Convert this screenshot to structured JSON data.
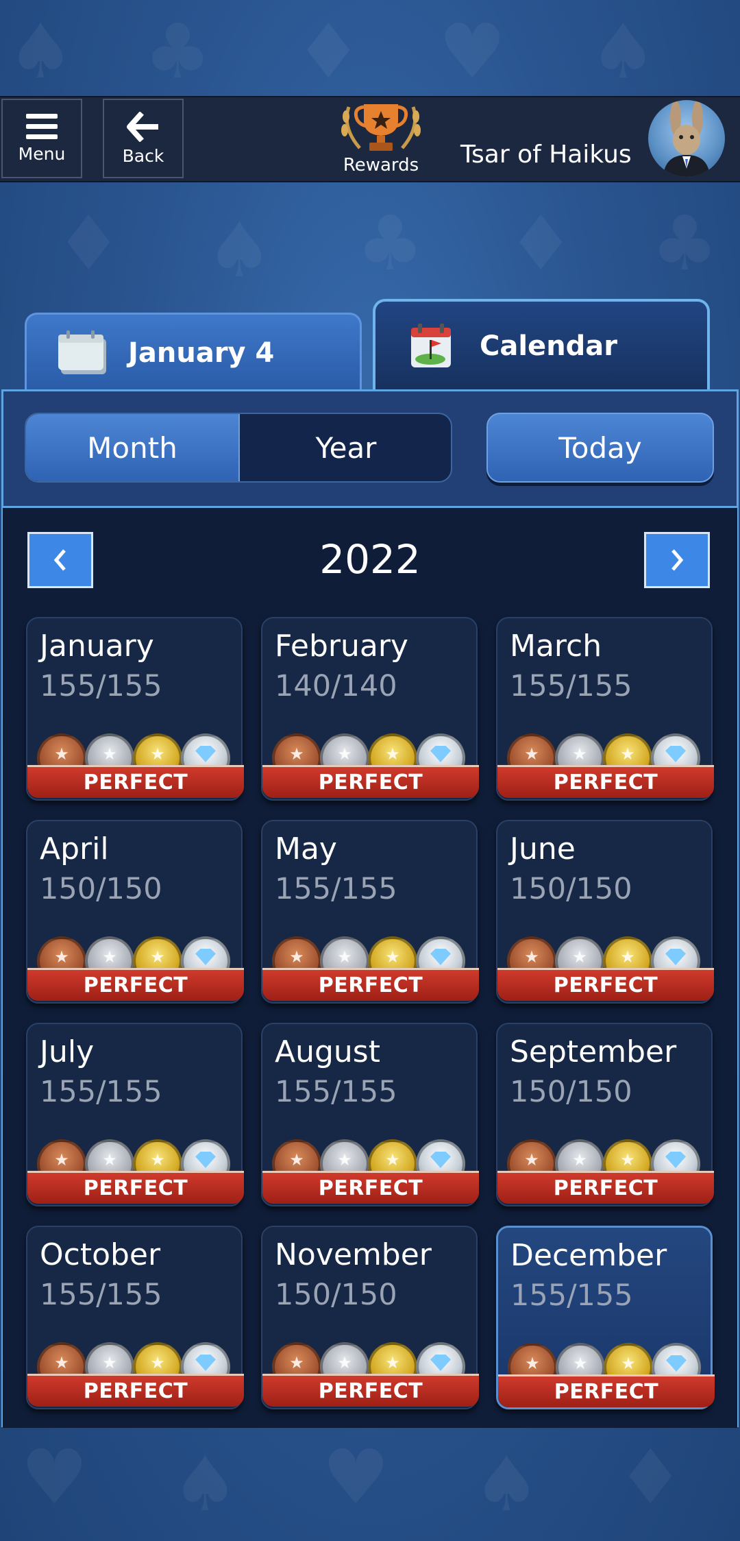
{
  "topbar": {
    "menu_label": "Menu",
    "back_label": "Back",
    "rewards_label": "Rewards",
    "username": "Tsar of Haikus"
  },
  "tabs": {
    "date_tab": "January 4",
    "calendar_tab": "Calendar"
  },
  "view_toggle": {
    "month": "Month",
    "year": "Year",
    "selected": "Month"
  },
  "today_label": "Today",
  "year": "2022",
  "badge_label": "PERFECT",
  "months": [
    {
      "name": "January",
      "count": "155/155"
    },
    {
      "name": "February",
      "count": "140/140"
    },
    {
      "name": "March",
      "count": "155/155"
    },
    {
      "name": "April",
      "count": "150/150"
    },
    {
      "name": "May",
      "count": "155/155"
    },
    {
      "name": "June",
      "count": "150/150"
    },
    {
      "name": "July",
      "count": "155/155"
    },
    {
      "name": "August",
      "count": "155/155"
    },
    {
      "name": "September",
      "count": "150/150"
    },
    {
      "name": "October",
      "count": "155/155"
    },
    {
      "name": "November",
      "count": "150/150"
    },
    {
      "name": "December",
      "count": "155/155"
    }
  ],
  "selected_month": "December",
  "colors": {
    "accent": "#3d87e6",
    "panel": "#223f76",
    "card": "#162845",
    "ribbon": "#c0302a"
  }
}
